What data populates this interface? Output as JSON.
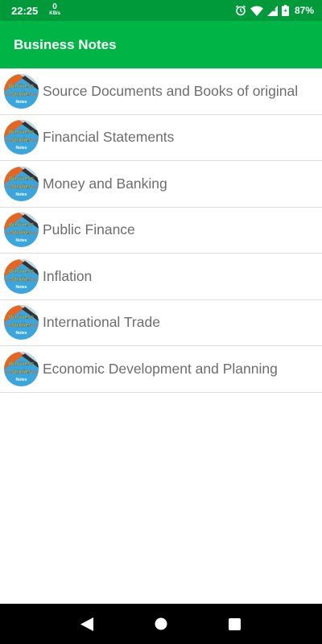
{
  "status_bar": {
    "time": "22:25",
    "net_speed_value": "0",
    "net_speed_unit": "KB/s",
    "battery_percent": "87%",
    "icons": [
      "alarm-icon",
      "wifi-icon",
      "signal-icon",
      "battery-icon"
    ]
  },
  "app_bar": {
    "title": "Business Notes",
    "color": "#00b446"
  },
  "chapters": [
    {
      "label": "Source Documents and Books of original",
      "icon_text": "Business Studies Notes"
    },
    {
      "label": "Financial Statements",
      "icon_text": "Business Studies Notes"
    },
    {
      "label": "Money and Banking",
      "icon_text": "Business Studies Notes"
    },
    {
      "label": "Public Finance",
      "icon_text": "Business Studies Notes"
    },
    {
      "label": "Inflation",
      "icon_text": "Business Studies Notes"
    },
    {
      "label": "International Trade",
      "icon_text": "Business Studies Notes"
    },
    {
      "label": "Economic Development and Planning",
      "icon_text": "Business Studies Notes"
    }
  ],
  "nav_bar": {
    "icons": [
      "back-icon",
      "home-icon",
      "recents-icon"
    ]
  }
}
